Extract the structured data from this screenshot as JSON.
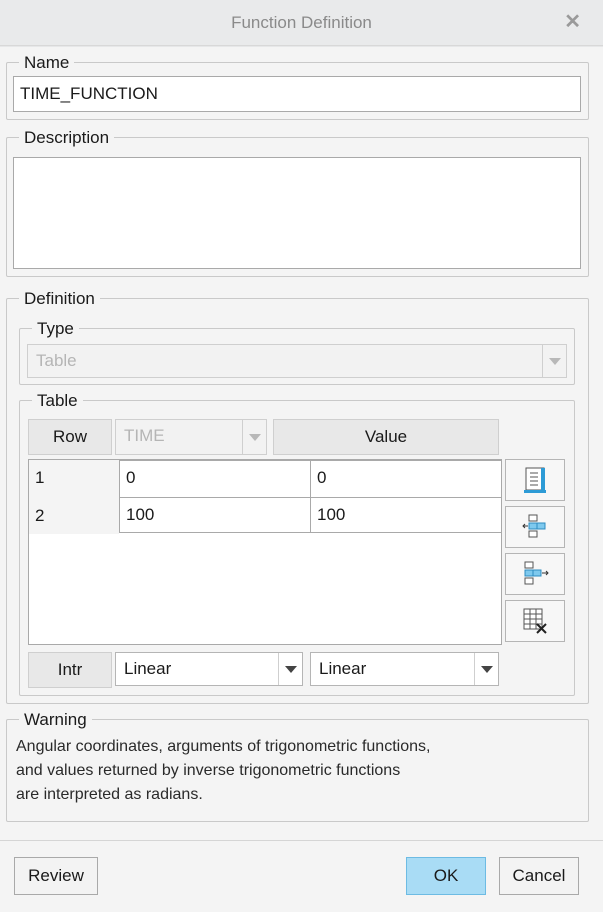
{
  "window": {
    "title": "Function Definition",
    "close_icon": "close-icon"
  },
  "name_group": {
    "legend": "Name",
    "value": "TIME_FUNCTION"
  },
  "description_group": {
    "legend": "Description",
    "value": ""
  },
  "definition_group": {
    "legend": "Definition",
    "type_group": {
      "legend": "Type",
      "selected": "Table"
    },
    "table_group": {
      "legend": "Table",
      "headers": {
        "row": "Row",
        "time_selected": "TIME",
        "value": "Value"
      },
      "rows": [
        {
          "index": "1",
          "time": "0",
          "value": "0"
        },
        {
          "index": "2",
          "time": "100",
          "value": "100"
        }
      ],
      "interp": {
        "label": "Intr",
        "time_interp": "Linear",
        "value_interp": "Linear"
      },
      "tools": [
        "table-edit-icon",
        "insert-row-before-icon",
        "insert-row-after-icon",
        "delete-table-icon"
      ]
    }
  },
  "warning_group": {
    "legend": "Warning",
    "lines": [
      "Angular coordinates, arguments of trigonometric functions,",
      "and values returned by inverse trigonometric functions",
      "are interpreted as radians."
    ]
  },
  "buttons": {
    "review": "Review",
    "ok": "OK",
    "cancel": "Cancel"
  },
  "colors": {
    "ok_accent": "#a9dcf5",
    "background": "#f4f4f4"
  }
}
